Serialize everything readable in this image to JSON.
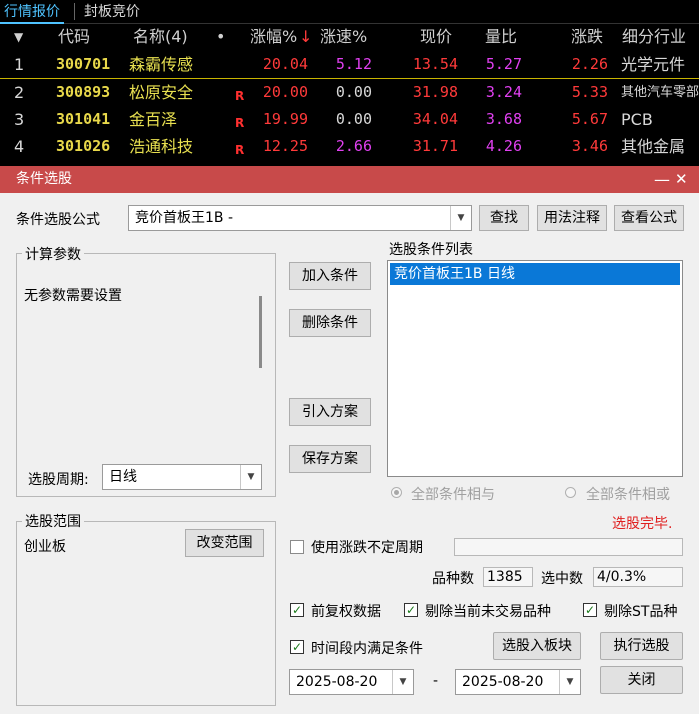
{
  "tabs": [
    "行情报价",
    "封板竞价"
  ],
  "quote_header": {
    "sort_icon": "▼",
    "code": "代码",
    "name": "名称(4)",
    "dot": "•",
    "change_pct": "涨幅%",
    "sort_arrow": "↓",
    "speed_pct": "涨速%",
    "price": "现价",
    "volume_ratio": "量比",
    "up_down": "涨跌",
    "industry": "细分行业"
  },
  "quotes": [
    {
      "idx": "1",
      "code": "300701",
      "name": "森霸传感",
      "flag": "",
      "change_pct": "20.04",
      "speed_pct": "5.12",
      "price": "13.54",
      "volume_ratio": "5.27",
      "up_down": "2.26",
      "industry": "光学元件"
    },
    {
      "idx": "2",
      "code": "300893",
      "name": "松原安全",
      "flag": "R",
      "change_pct": "20.00",
      "speed_pct": "0.00",
      "price": "31.98",
      "volume_ratio": "3.24",
      "up_down": "5.33",
      "industry": "其他汽车零部"
    },
    {
      "idx": "3",
      "code": "301041",
      "name": "金百泽",
      "flag": "R",
      "change_pct": "19.99",
      "speed_pct": "0.00",
      "price": "34.04",
      "volume_ratio": "3.68",
      "up_down": "5.67",
      "industry": "PCB"
    },
    {
      "idx": "4",
      "code": "301026",
      "name": "浩通科技",
      "flag": "R",
      "change_pct": "12.25",
      "speed_pct": "2.66",
      "price": "31.71",
      "volume_ratio": "4.26",
      "up_down": "3.46",
      "industry": "其他金属"
    }
  ],
  "dialog": {
    "title": "条件选股",
    "minimize": "—",
    "close": "✕",
    "formula_label": "条件选股公式",
    "formula_value": "竞价首板王1B  -",
    "find_button": "查找",
    "usage_button": "用法注释",
    "view_formula_button": "查看公式",
    "params_legend": "计算参数",
    "params_text": "无参数需要设置",
    "period_label": "选股周期:",
    "period_value": "日线",
    "add_condition": "加入条件",
    "delete_condition": "删除条件",
    "import_scheme": "引入方案",
    "save_scheme": "保存方案",
    "condition_list_label": "选股条件列表",
    "condition_list": [
      "竞价首板王1B  日线"
    ],
    "radio_and": "全部条件相与",
    "radio_or": "全部条件相或",
    "status": "选股完毕.",
    "range_legend": "选股范围",
    "range_value": "创业板",
    "change_range": "改变范围",
    "use_uncertain_period": "使用涨跌不定周期",
    "count_label": "品种数",
    "count_value": "1385",
    "selected_label": "选中数",
    "selected_value": "4/0.3%",
    "pre_adjust": "前复权数据",
    "exclude_untraded": "剔除当前未交易品种",
    "exclude_st": "剔除ST品种",
    "time_range": "时间段内满足条件",
    "to_block_button": "选股入板块",
    "execute_button": "执行选股",
    "date_from": "2025-08-20",
    "date_sep": "-",
    "date_to": "2025-08-20",
    "close_button": "关闭",
    "check_mark": "✓"
  },
  "colors": {
    "titlebar": "#c84a4a",
    "selection": "#0a78d7",
    "up_red": "#ff3a3a",
    "code_yellow": "#e8d84a",
    "volume_magenta": "#e040f0",
    "status_red": "#e02020"
  }
}
